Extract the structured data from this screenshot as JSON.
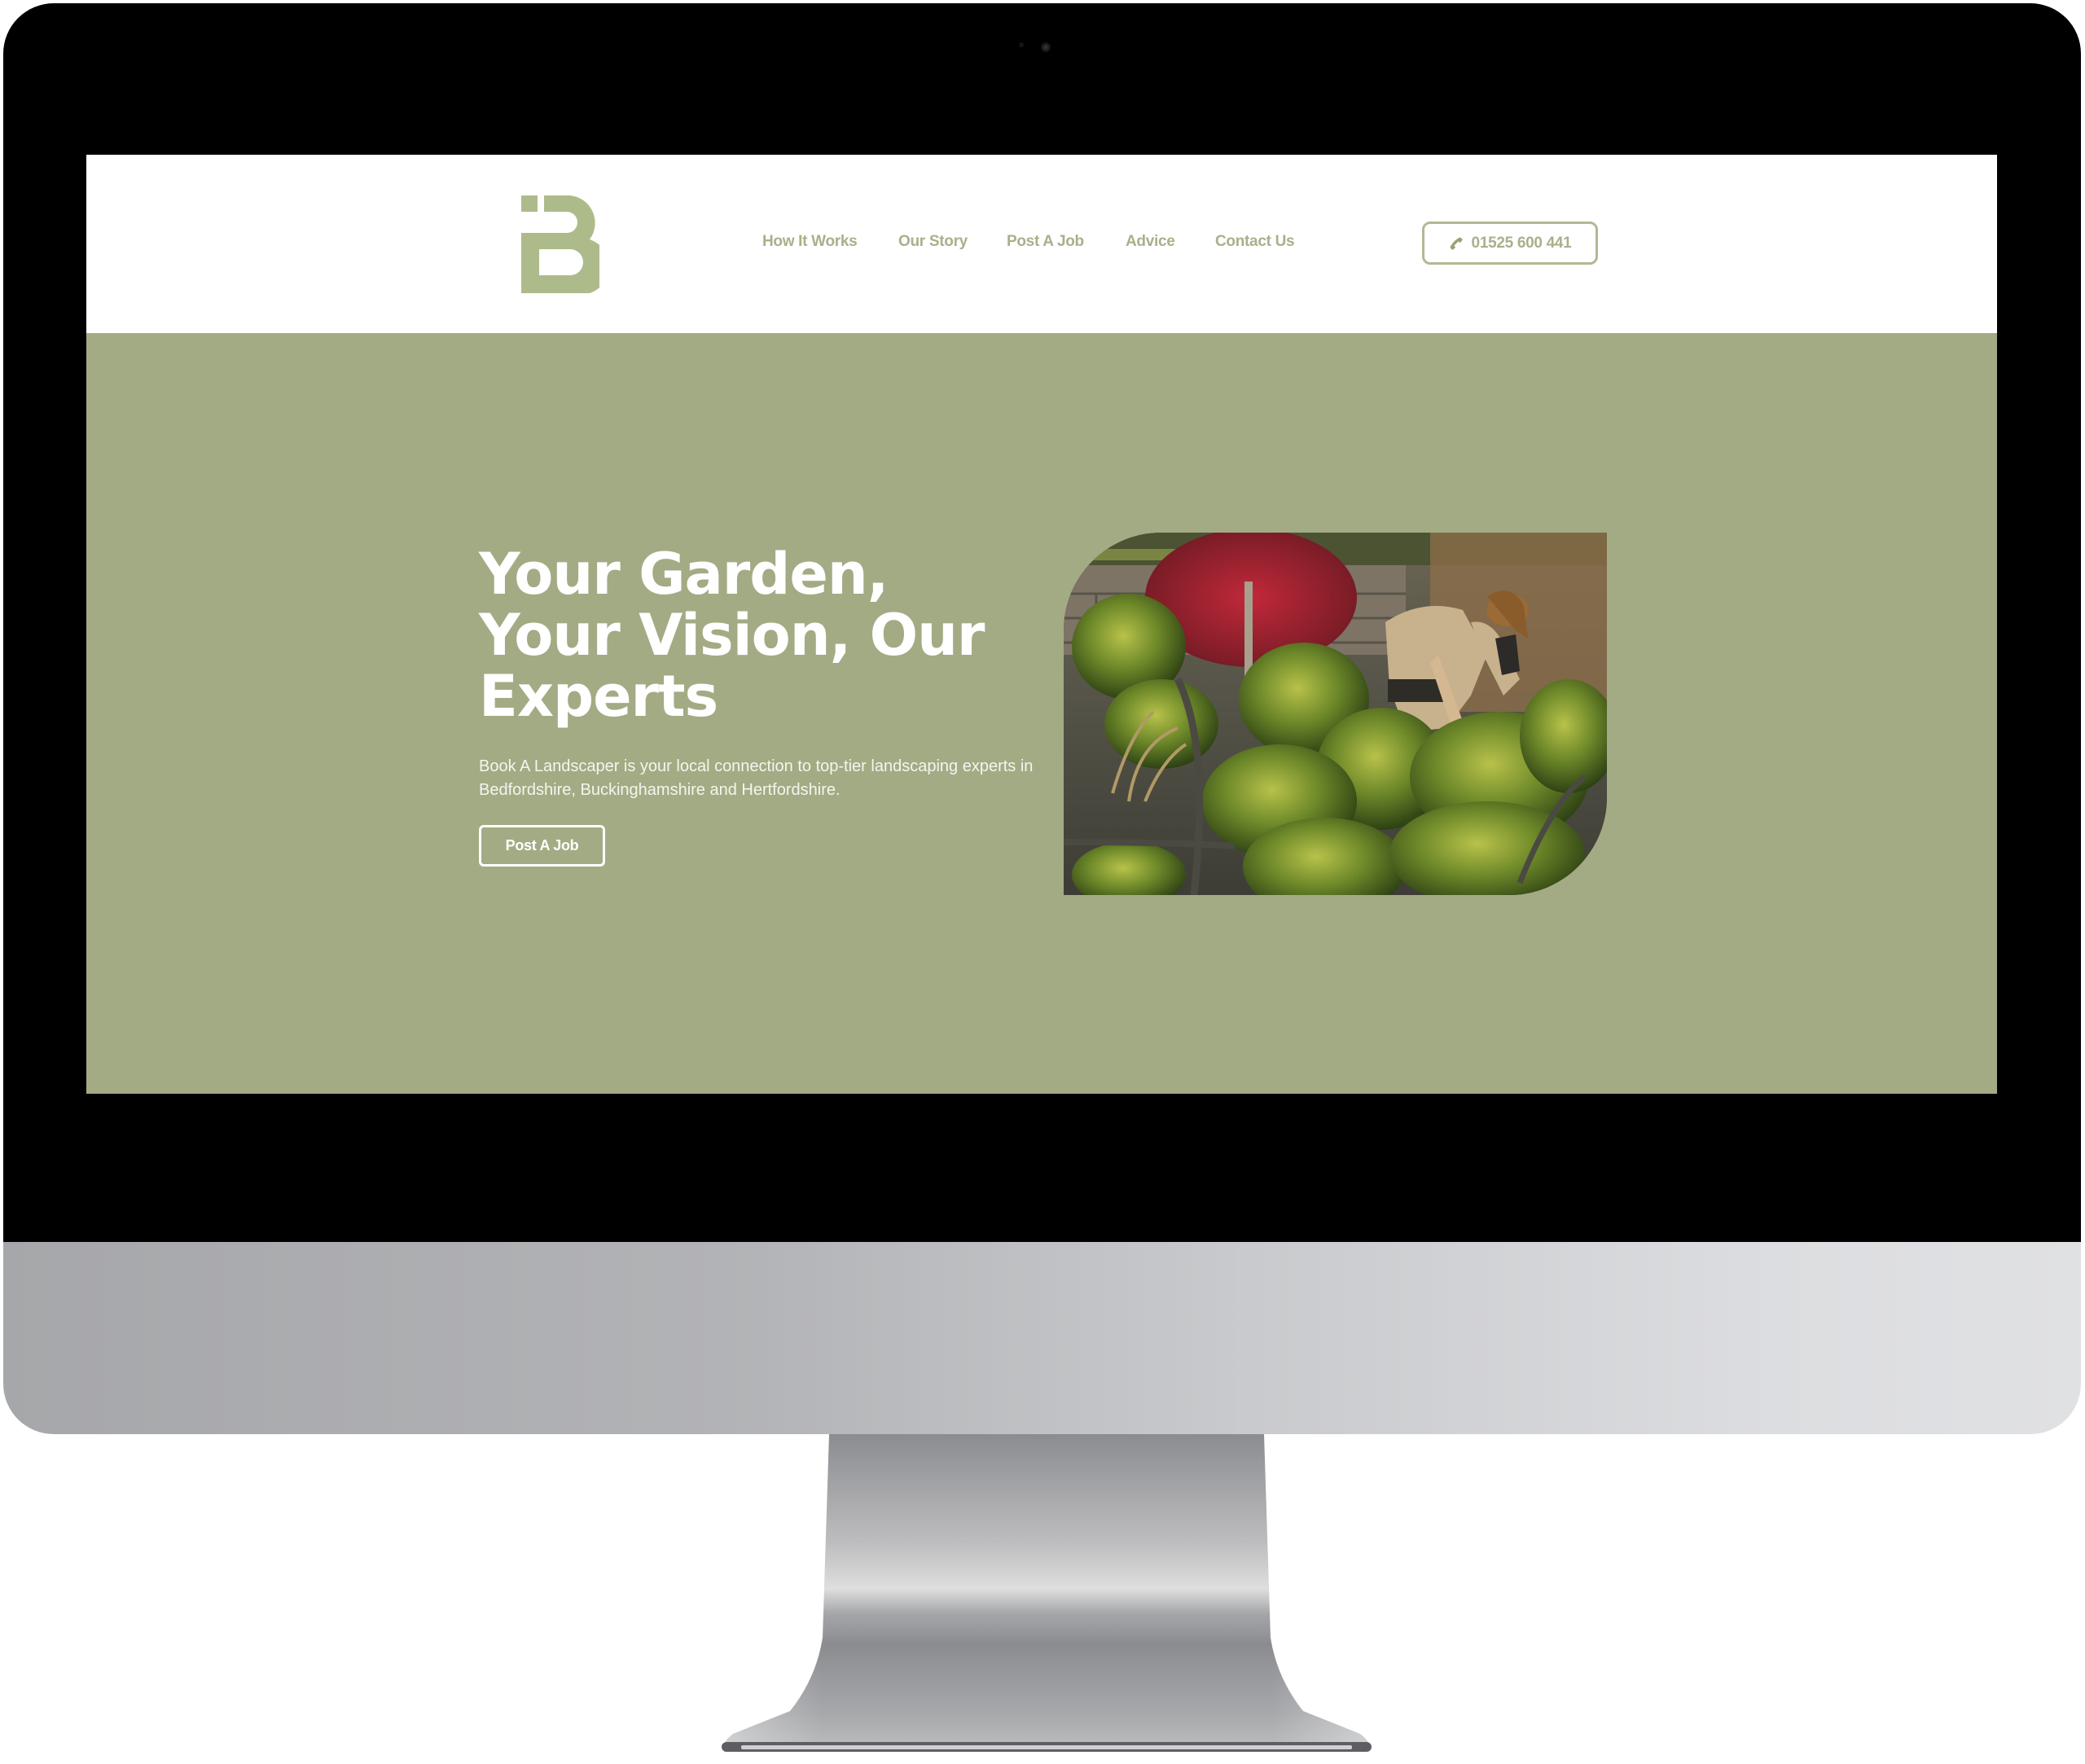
{
  "site": {
    "brand": "Book A Landscaper",
    "logo_letter": "B",
    "accent_color": "#a3ab84",
    "logo_color": "#adbb8a"
  },
  "header": {
    "nav": [
      {
        "label": "How It Works"
      },
      {
        "label": "Our Story"
      },
      {
        "label": "Post A Job"
      },
      {
        "label": "Advice"
      },
      {
        "label": "Contact Us"
      }
    ],
    "phone": {
      "icon": "phone-icon",
      "label": "01525 600 441"
    }
  },
  "hero": {
    "title_lines": [
      "Your Garden,",
      "Your Vision, Our",
      "Experts"
    ],
    "subtitle": "Book A Landscaper is your local connection to top-tier landscaping experts in Bedfordshire, Buckinghamshire and Hertfordshire.",
    "cta_label": "Post A Job",
    "image_alt": "Landscaper tending shrubs in a garden"
  }
}
